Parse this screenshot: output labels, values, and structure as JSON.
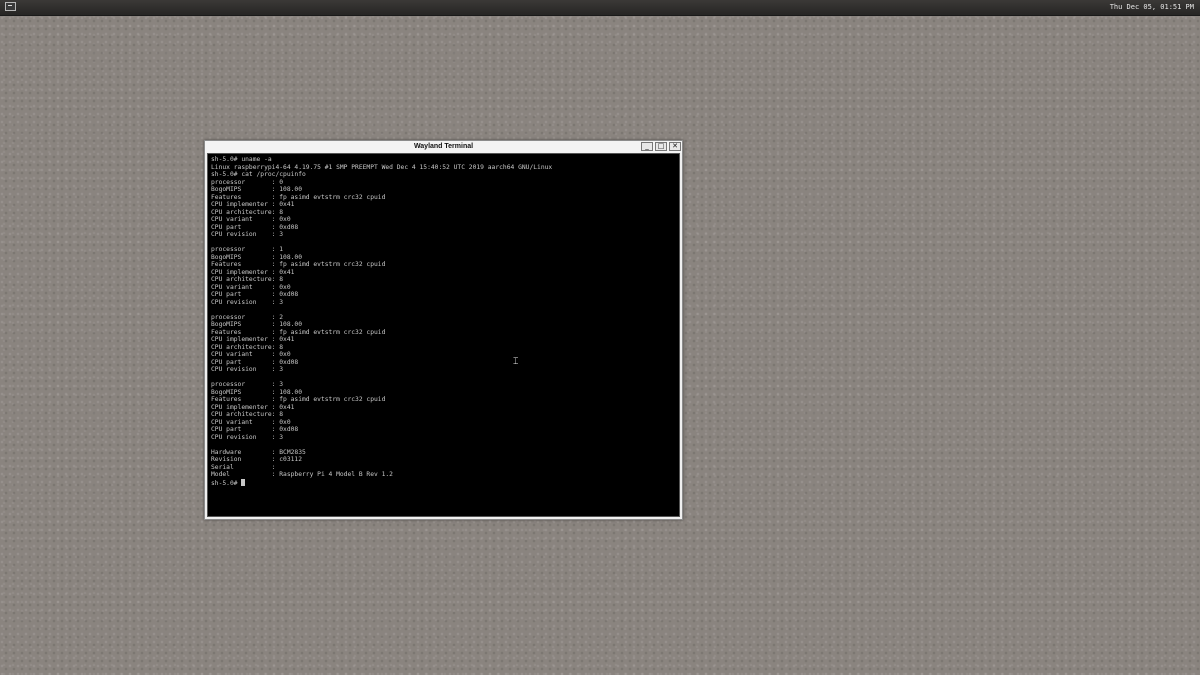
{
  "taskbar": {
    "launcher_icon": "terminal-icon",
    "clock": "Thu Dec 05, 01:51 PM"
  },
  "window": {
    "title": "Wayland Terminal",
    "minimize_label": "_",
    "maximize_label": "□",
    "close_label": "✕"
  },
  "terminal": {
    "lines": [
      "sh-5.0# uname -a",
      "Linux raspberrypi4-64 4.19.75 #1 SMP PREEMPT Wed Dec 4 15:40:52 UTC 2019 aarch64 GNU/Linux",
      "sh-5.0# cat /proc/cpuinfo",
      "processor       : 0",
      "BogoMIPS        : 108.00",
      "Features        : fp asimd evtstrm crc32 cpuid",
      "CPU implementer : 0x41",
      "CPU architecture: 8",
      "CPU variant     : 0x0",
      "CPU part        : 0xd08",
      "CPU revision    : 3",
      "",
      "processor       : 1",
      "BogoMIPS        : 108.00",
      "Features        : fp asimd evtstrm crc32 cpuid",
      "CPU implementer : 0x41",
      "CPU architecture: 8",
      "CPU variant     : 0x0",
      "CPU part        : 0xd08",
      "CPU revision    : 3",
      "",
      "processor       : 2",
      "BogoMIPS        : 108.00",
      "Features        : fp asimd evtstrm crc32 cpuid",
      "CPU implementer : 0x41",
      "CPU architecture: 8",
      "CPU variant     : 0x0",
      "CPU part        : 0xd08",
      "CPU revision    : 3",
      "",
      "processor       : 3",
      "BogoMIPS        : 108.00",
      "Features        : fp asimd evtstrm crc32 cpuid",
      "CPU implementer : 0x41",
      "CPU architecture: 8",
      "CPU variant     : 0x0",
      "CPU part        : 0xd08",
      "CPU revision    : 3",
      "",
      "Hardware        : BCM2835",
      "Revision        : c03112",
      "Serial          :",
      "Model           : Raspberry Pi 4 Model B Rev 1.2"
    ],
    "prompt": "sh-5.0# "
  },
  "mouse_cursor_icon": "text-cursor-icon",
  "colors": {
    "desktop": "#8a847f",
    "taskbar": "#2f2d2b",
    "terminal_bg": "#000000",
    "terminal_fg": "#c8c8c8"
  }
}
